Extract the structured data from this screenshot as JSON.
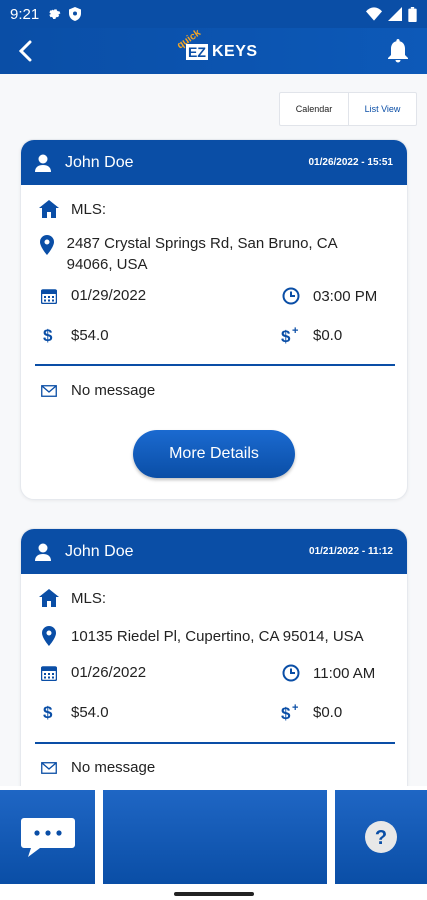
{
  "status_bar": {
    "time": "9:21"
  },
  "app_bar": {
    "logo_ez": "EZ",
    "logo_keys": "KEYS",
    "logo_quick": "quick"
  },
  "view_toggle": {
    "calendar_label": "Calendar",
    "list_label": "List View"
  },
  "cards": [
    {
      "name": "John Doe",
      "timestamp": "01/26/2022 - 15:51",
      "mls_label": "MLS:",
      "address": "2487 Crystal Springs Rd, San Bruno, CA 94066, USA",
      "date": "01/29/2022",
      "time": "03:00 PM",
      "fee": "$54.0",
      "extra_fee": "$0.0",
      "message": "No message",
      "button_label": "More Details"
    },
    {
      "name": "John Doe",
      "timestamp": "01/21/2022 - 11:12",
      "mls_label": "MLS:",
      "address": "10135 Riedel Pl, Cupertino, CA 95014, USA",
      "date": "01/26/2022",
      "time": "11:00 AM",
      "fee": "$54.0",
      "extra_fee": "$0.0",
      "message": "No message"
    }
  ],
  "bottom_nav": {
    "help_label": "?"
  },
  "colors": {
    "primary": "#0a4ea6",
    "background": "#f7f8fa"
  }
}
